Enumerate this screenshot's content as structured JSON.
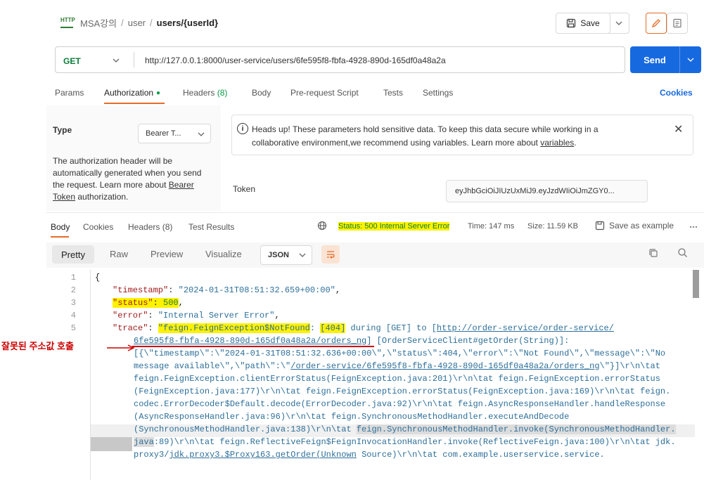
{
  "breadcrumb": {
    "icon": "http-icon",
    "icon_text": "HTTP",
    "collection": "MSA강의",
    "folder": "user",
    "request": "users/{userId}"
  },
  "toolbar": {
    "save_label": "Save"
  },
  "request": {
    "method": "GET",
    "url": "http://127.0.0.1:8000/user-service/users/6fe595f8-fbfa-4928-890d-165df0a48a2a",
    "send_label": "Send"
  },
  "request_tabs": {
    "params": "Params",
    "authorization": "Authorization",
    "headers": "Headers",
    "headers_count": "(8)",
    "body": "Body",
    "prerequest": "Pre-request Script",
    "tests": "Tests",
    "settings": "Settings",
    "cookies": "Cookies"
  },
  "auth": {
    "type_label": "Type",
    "type_value": "Bearer T...",
    "desc_1": "The authorization header will be automatically generated when you send the request. Learn more about",
    "desc_link": "Bearer Token",
    "desc_2": "authorization.",
    "warning_1": "Heads up! These parameters hold sensitive data. To keep this data secure while working in a collaborative environment,we recommend using variables. Learn more about",
    "warning_link": "variables",
    "warning_2": ".",
    "token_label": "Token",
    "token_value": "eyJhbGciOiJIUzUxMiJ9.eyJzdWIiOiJmZGY0..."
  },
  "response_tabs": {
    "body": "Body",
    "cookies": "Cookies",
    "headers": "Headers (8)",
    "test_results": "Test Results",
    "status": "Status: 500 Internal Server Error",
    "time": "Time: 147 ms",
    "size": "Size: 11.59 KB",
    "save_example": "Save as example"
  },
  "body_toolbar": {
    "pretty": "Pretty",
    "raw": "Raw",
    "preview": "Preview",
    "visualize": "Visualize",
    "format": "JSON"
  },
  "code": {
    "line_numbers": [
      "1",
      "2",
      "3",
      "4",
      "5"
    ],
    "l1": "{",
    "l2_key": "\"timestamp\"",
    "l2_val": "\"2024-01-31T08:51:32.659+00:00\"",
    "l3_key": "\"status\"",
    "l3_val": "500",
    "l4_key": "\"error\"",
    "l4_val": "\"Internal Server Error\"",
    "l5_key": "\"trace\"",
    "l5_hl1": "\"feign.FeignException$NotFound",
    "l5_hl2": "[404]",
    "l5_mid": " during [GET] to [",
    "l5_link": "http://order-service/order-service/",
    "w1_link": "6fe595f8-fbfa-4928-890d-165df0a48a2a/orders_ng",
    "w1_rest": "] [OrderServiceClient#getOrder(String)]:",
    "w2": "[{\\\"timestamp\\\":\\\"2024-01-31T08:51:32.636+00:00\\\",\\\"status\\\":404,\\\"error\\\":\\\"Not Found\\\",\\\"message\\\":\\\"No",
    "w3_a": "message available\\\",\\\"path\\\":\\\"",
    "w3_link": "/order-service/6fe595f8-fbfa-4928-890d-165df0a48a2a/orders_ng",
    "w3_b": "\\\"}]\\r\\n\\tat",
    "w4": "feign.FeignException.clientErrorStatus(FeignException.java:201)\\r\\n\\tat feign.FeignException.errorStatus",
    "w5": "(FeignException.java:177)\\r\\n\\tat feign.FeignException.errorStatus(FeignException.java:169)\\r\\n\\tat feign.",
    "w6": "codec.ErrorDecoder$Default.decode(ErrorDecoder.java:92)\\r\\n\\tat feign.AsyncResponseHandler.handleResponse",
    "w7": "(AsyncResponseHandler.java:96)\\r\\n\\tat feign.SynchronousMethodHandler.executeAndDecode",
    "w8_a": "(SynchronousMethodHandler.java:138)\\r\\n\\tat ",
    "w8_sel": "feign.SynchronousMethodHandler.invoke(SynchronousMethodHandler.",
    "w9_sel": "java",
    "w9_rest": ":89)\\r\\n\\tat feign.ReflectiveFeign$FeignInvocationHandler.invoke(ReflectiveFeign.java:100)\\r\\n\\tat jdk.",
    "w10_a": "proxy3/",
    "w10_link": "jdk.proxy3.$Proxy163.getOrder(Unknown",
    "w10_b": " Source)\\r\\n\\tat com.example.userservice.service."
  },
  "annotation": {
    "text": "잘못된 주소값 호출"
  },
  "colors": {
    "accent": "#e46c28",
    "send": "#1769e0",
    "method": "#0a7d38",
    "highlight": "#fff200",
    "annotation": "#c00000"
  }
}
